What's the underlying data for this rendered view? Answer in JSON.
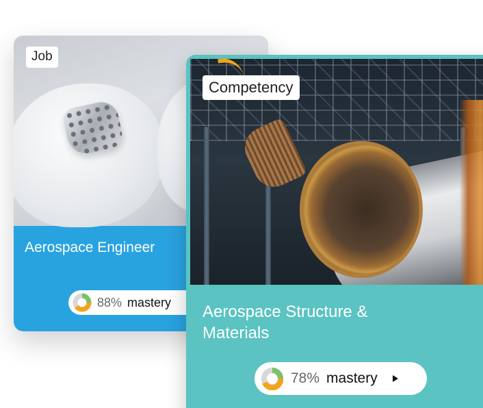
{
  "job_card": {
    "tag": "Job",
    "title": "Aerospace Engineer",
    "mastery_percent": "88%",
    "mastery_word": "mastery",
    "mastery_value": 88
  },
  "competency_card": {
    "tag": "Competency",
    "title": "Aerospace Structure & Materials",
    "mastery_percent": "78%",
    "mastery_word": "mastery",
    "mastery_value": 78
  },
  "colors": {
    "job_accent": "#29a3e0",
    "competency_accent": "#5bc3c1",
    "donut_orange": "#f2a41b",
    "donut_green": "#7bc26b"
  },
  "icons": {
    "mastery": "donut-chart-icon",
    "open": "play-arrow-icon"
  }
}
